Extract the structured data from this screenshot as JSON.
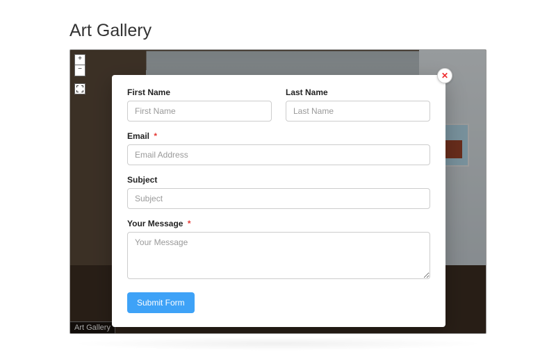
{
  "page": {
    "title": "Art Gallery",
    "caption": "Art Gallery"
  },
  "controls": {
    "zoom_in": "+",
    "zoom_out": "−"
  },
  "modal": {
    "close_symbol": "✕"
  },
  "form": {
    "first_name": {
      "label": "First Name",
      "placeholder": "First Name",
      "value": ""
    },
    "last_name": {
      "label": "Last Name",
      "placeholder": "Last Name",
      "value": ""
    },
    "email": {
      "label": "Email",
      "placeholder": "Email Address",
      "value": "",
      "required_mark": "*"
    },
    "subject": {
      "label": "Subject",
      "placeholder": "Subject",
      "value": ""
    },
    "message": {
      "label": "Your Message",
      "placeholder": "Your Message",
      "value": "",
      "required_mark": "*"
    },
    "submit_label": "Submit Form"
  }
}
